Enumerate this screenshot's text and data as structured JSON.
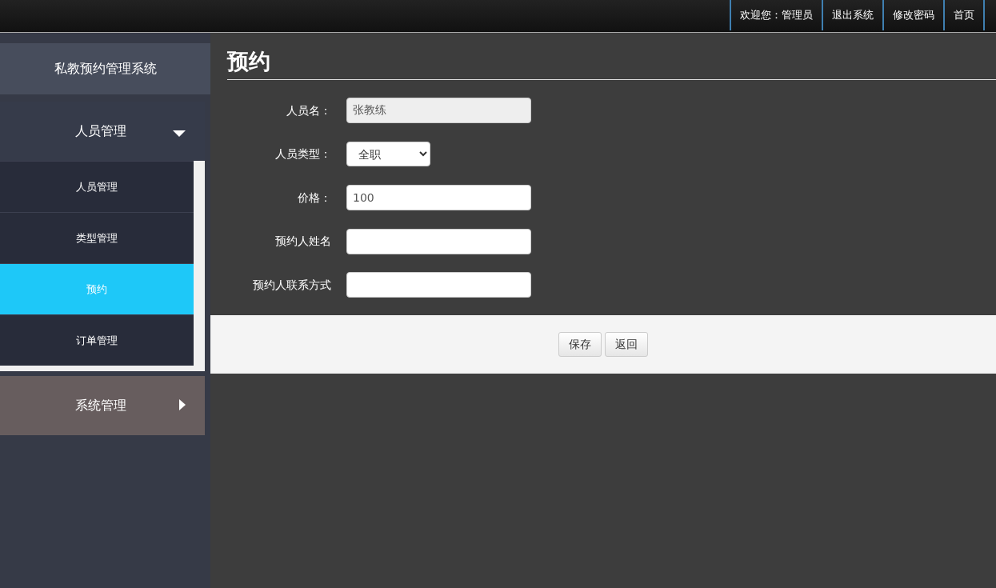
{
  "top_nav": [
    {
      "label": "欢迎您：管理员"
    },
    {
      "label": "退出系统"
    },
    {
      "label": "修改密码"
    },
    {
      "label": "首页"
    }
  ],
  "sidebar": {
    "brand": "私教预约管理系统",
    "groups": [
      {
        "label": "人员管理",
        "expanded": true,
        "items": [
          {
            "label": "人员管理",
            "selected": false
          },
          {
            "label": "类型管理",
            "selected": false
          },
          {
            "label": "预约",
            "selected": true
          },
          {
            "label": "订单管理",
            "selected": false
          }
        ]
      },
      {
        "label": "系统管理",
        "expanded": false
      }
    ]
  },
  "page_title": "预约",
  "form": [
    {
      "kind": "text",
      "label": "人员名：",
      "value": "张教练",
      "disabled": true
    },
    {
      "kind": "select",
      "label": "人员类型：",
      "value": "全职"
    },
    {
      "kind": "text",
      "label": "价格：",
      "value": "100"
    },
    {
      "kind": "text",
      "label": "预约人姓名"
    },
    {
      "kind": "text",
      "label": "预约人联系方式"
    }
  ],
  "buttons": [
    "保存",
    "返回"
  ]
}
